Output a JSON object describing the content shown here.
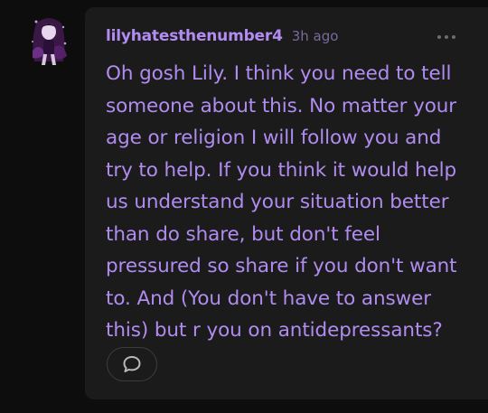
{
  "comment": {
    "username": "lilyhatesthenumber4",
    "timestamp": "3h ago",
    "text": "Oh gosh Lily. I think you need to tell someone about this. No matter your age or religion I will follow you and try to help. If you think it would help us understand your situation better than do share, but don't feel pressured so share if you don't want to. And (You don't have to answer this) but r you on antidepressants?"
  },
  "icons": {
    "more": "more-horizontal-icon",
    "reply": "speech-bubble-icon"
  },
  "colors": {
    "background": "#0d0d0d",
    "card": "#1b1b1b",
    "accent_text": "#b18cf0",
    "timestamp": "#7a6a9c"
  }
}
